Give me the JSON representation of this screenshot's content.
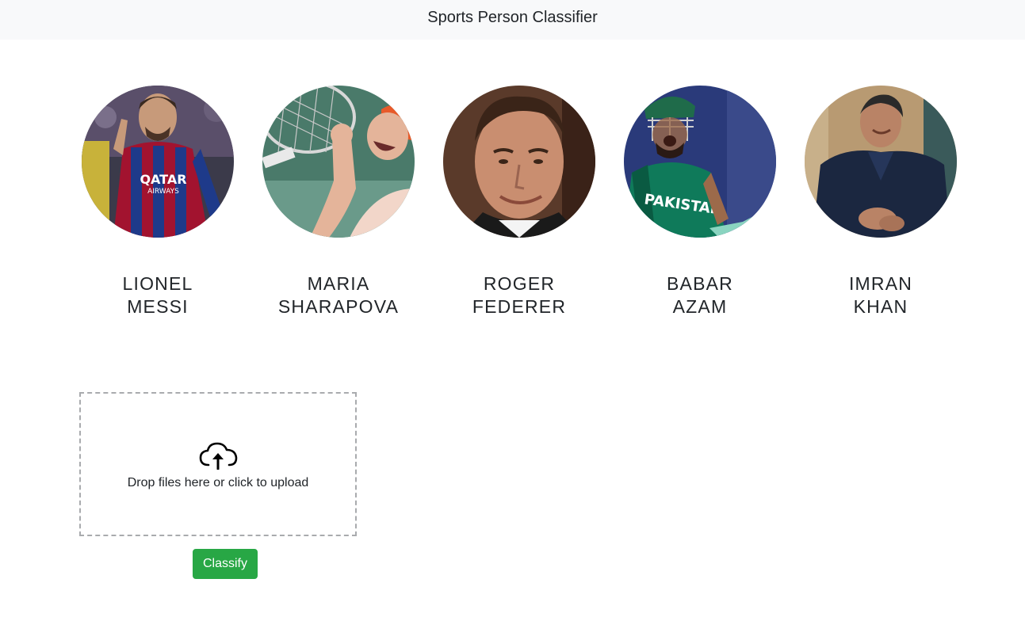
{
  "navbar": {
    "title": "Sports Person Classifier"
  },
  "players": [
    {
      "first": "LIONEL",
      "last": "MESSI"
    },
    {
      "first": "MARIA",
      "last": "SHARAPOVA"
    },
    {
      "first": "ROGER",
      "last": "FEDERER"
    },
    {
      "first": "BABAR",
      "last": "AZAM"
    },
    {
      "first": "IMRAN",
      "last": "KHAN"
    }
  ],
  "upload": {
    "icon": "cloud-upload-icon",
    "message": "Drop files here or click to upload"
  },
  "actions": {
    "classify_label": "Classify",
    "classify_color": "#28a745"
  }
}
